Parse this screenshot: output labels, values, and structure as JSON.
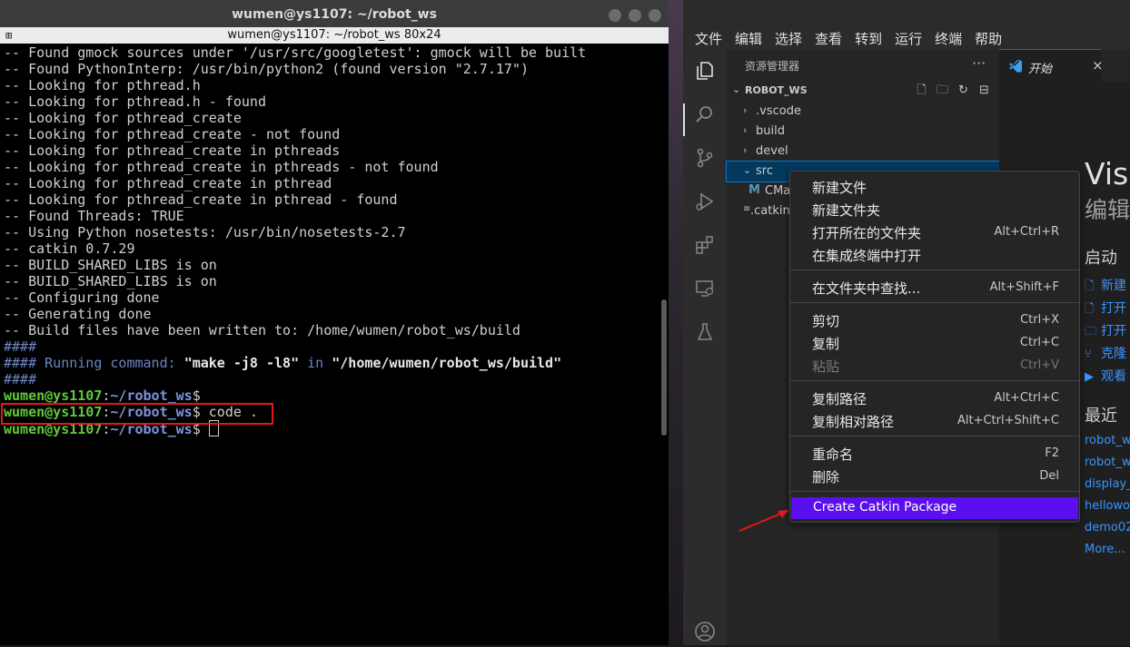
{
  "terminal": {
    "window_title": "wumen@ys1107: ~/robot_ws",
    "sub_title": "wumen@ys1107: ~/robot_ws 80x24",
    "lines": [
      "-- Found gmock sources under '/usr/src/googletest': gmock will be built",
      "-- Found PythonInterp: /usr/bin/python2 (found version \"2.7.17\")",
      "-- Looking for pthread.h",
      "-- Looking for pthread.h - found",
      "-- Looking for pthread_create",
      "-- Looking for pthread_create - not found",
      "-- Looking for pthread_create in pthreads",
      "-- Looking for pthread_create in pthreads - not found",
      "-- Looking for pthread_create in pthread",
      "-- Looking for pthread_create in pthread - found",
      "-- Found Threads: TRUE",
      "-- Using Python nosetests: /usr/bin/nosetests-2.7",
      "-- catkin 0.7.29",
      "-- BUILD_SHARED_LIBS is on",
      "-- BUILD_SHARED_LIBS is on",
      "-- Configuring done",
      "-- Generating done",
      "-- Build files have been written to: /home/wumen/robot_ws/build"
    ],
    "hash_line": "####",
    "running_prefix": "#### Running command: ",
    "running_cmd": "\"make -j8 -l8\"",
    "running_in": " in ",
    "running_dir": "\"/home/wumen/robot_ws/build\"",
    "prompt_user": "wumen@ys1107",
    "prompt_sep": ":",
    "prompt_path": "~/robot_ws",
    "prompt_dollar": "$",
    "command": " code ."
  },
  "vscode": {
    "menu": [
      "文件",
      "编辑",
      "选择",
      "查看",
      "转到",
      "运行",
      "终端",
      "帮助"
    ],
    "explorer_title": "资源管理器",
    "more_label": "···",
    "workspace": "ROBOT_WS",
    "tree": [
      {
        "label": ".vscode",
        "chevron": "›"
      },
      {
        "label": "build",
        "chevron": "›"
      },
      {
        "label": "devel",
        "chevron": "›"
      },
      {
        "label": "src",
        "chevron": "⌄"
      },
      {
        "label": "CMa",
        "icon": "M"
      },
      {
        "label": ".catkin"
      }
    ],
    "tab_label": "开始",
    "tab_close": "×",
    "welcome_title": "Vis",
    "welcome_sub": "编辑",
    "start_heading": "启动",
    "start_items": [
      "新建",
      "打开",
      "打开",
      "克隆",
      "观看"
    ],
    "recent_heading": "最近",
    "recent_items": [
      "robot_w",
      "robot_w",
      "display_",
      "hellowo",
      "demo02"
    ],
    "more_link": "More..."
  },
  "context_menu": {
    "items": [
      {
        "label": "新建文件",
        "shortcut": ""
      },
      {
        "label": "新建文件夹",
        "shortcut": ""
      },
      {
        "label": "打开所在的文件夹",
        "shortcut": "Alt+Ctrl+R"
      },
      {
        "label": "在集成终端中打开",
        "shortcut": ""
      },
      {
        "label": "在文件夹中查找...",
        "shortcut": "Alt+Shift+F"
      },
      {
        "label": "剪切",
        "shortcut": "Ctrl+X"
      },
      {
        "label": "复制",
        "shortcut": "Ctrl+C"
      },
      {
        "label": "粘贴",
        "shortcut": "Ctrl+V"
      },
      {
        "label": "复制路径",
        "shortcut": "Alt+Ctrl+C"
      },
      {
        "label": "复制相对路径",
        "shortcut": "Alt+Ctrl+Shift+C"
      },
      {
        "label": "重命名",
        "shortcut": "F2"
      },
      {
        "label": "删除",
        "shortcut": "Del"
      },
      {
        "label": "Create Catkin Package",
        "shortcut": ""
      }
    ]
  },
  "colors": {
    "highlight": "#5b0ef0",
    "annotation_red": "#e01a1a",
    "prompt_green": "#5fc93a",
    "link_blue": "#3794ff"
  }
}
